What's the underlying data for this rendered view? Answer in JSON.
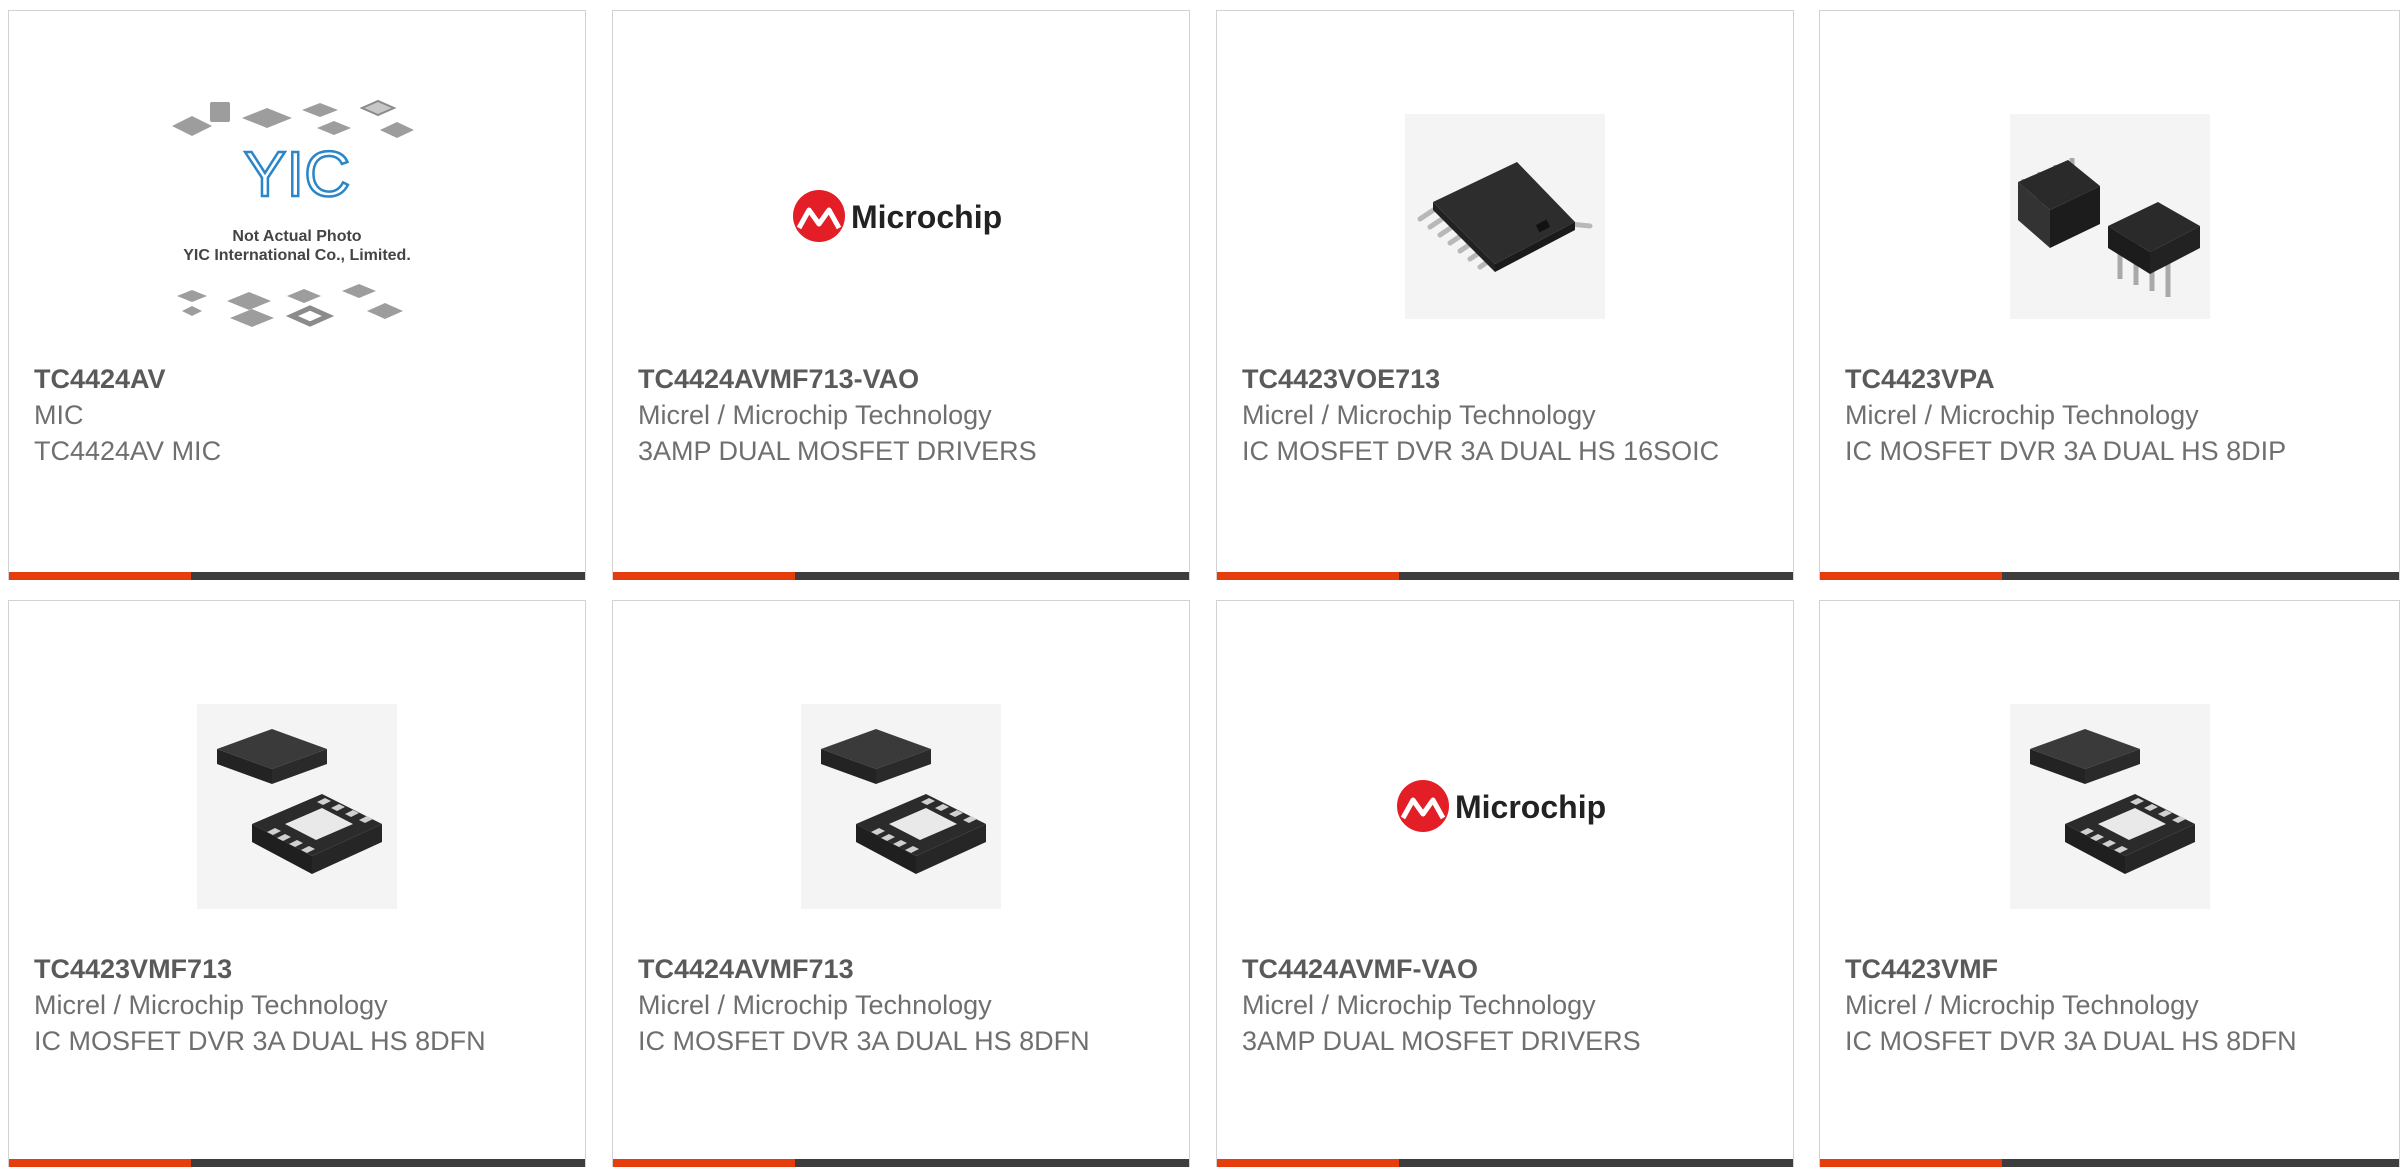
{
  "colors": {
    "accent": "#e63d0f",
    "bar": "#3d3d3d",
    "border": "#d2d2d2",
    "title": "#5a5a5a",
    "text": "#6f6f6f",
    "microchip_red": "#e31e26"
  },
  "placeholder": {
    "line1": "Not Actual Photo",
    "line2": "YIC International Co., Limited.",
    "logo": "YIC"
  },
  "logo_text": "Microchip",
  "products": [
    {
      "pn": "TC4424AV",
      "mfr": "MIC",
      "desc": "TC4424AV MIC",
      "image": "yic-placeholder"
    },
    {
      "pn": "TC4424AVMF713-VAO",
      "mfr": "Micrel / Microchip Technology",
      "desc": "3AMP DUAL MOSFET DRIVERS",
      "image": "microchip-logo"
    },
    {
      "pn": "TC4423VOE713",
      "mfr": "Micrel / Microchip Technology",
      "desc": "IC MOSFET DVR 3A DUAL HS 16SOIC",
      "image": "soic-chip"
    },
    {
      "pn": "TC4423VPA",
      "mfr": "Micrel / Microchip Technology",
      "desc": "IC MOSFET DVR 3A DUAL HS 8DIP",
      "image": "dip-chip"
    },
    {
      "pn": "TC4423VMF713",
      "mfr": "Micrel / Microchip Technology",
      "desc": "IC MOSFET DVR 3A DUAL HS 8DFN",
      "image": "dfn-chip"
    },
    {
      "pn": "TC4424AVMF713",
      "mfr": "Micrel / Microchip Technology",
      "desc": "IC MOSFET DVR 3A DUAL HS 8DFN",
      "image": "dfn-chip"
    },
    {
      "pn": "TC4424AVMF-VAO",
      "mfr": "Micrel / Microchip Technology",
      "desc": "3AMP DUAL MOSFET DRIVERS",
      "image": "microchip-logo"
    },
    {
      "pn": "TC4423VMF",
      "mfr": "Micrel / Microchip Technology",
      "desc": "IC MOSFET DVR 3A DUAL HS 8DFN",
      "image": "dfn-chip"
    }
  ]
}
